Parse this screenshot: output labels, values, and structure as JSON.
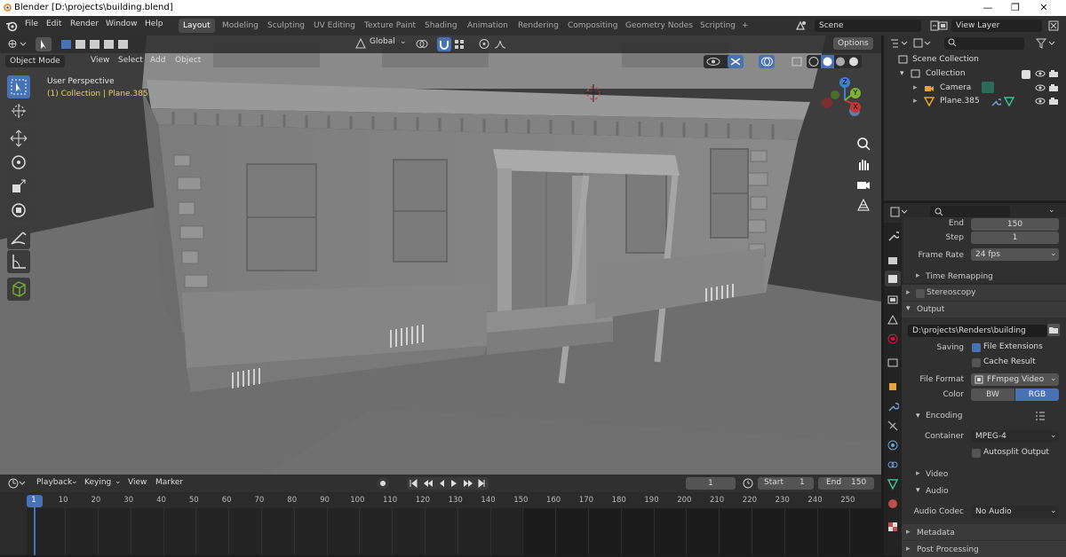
{
  "app": {
    "title": "Blender [D:\\projects\\building.blend]"
  },
  "window_controls": {
    "minimize": "—",
    "maximize": "❐",
    "close": "✕"
  },
  "menu": [
    "File",
    "Edit",
    "Render",
    "Window",
    "Help"
  ],
  "workspaces": [
    "Layout",
    "Modeling",
    "Sculpting",
    "UV Editing",
    "Texture Paint",
    "Shading",
    "Animation",
    "Rendering",
    "Compositing",
    "Geometry Nodes",
    "Scripting"
  ],
  "workspace_add": "+",
  "scene": {
    "name": "Scene"
  },
  "view_layer": {
    "name": "View Layer"
  },
  "viewport": {
    "mode": "Object Mode",
    "header_menus": [
      "View",
      "Select",
      "Add",
      "Object"
    ],
    "orientation": "Global",
    "options_label": "Options",
    "overlay_title": "User Perspective",
    "overlay_subtitle": "(1) Collection | Plane.385",
    "gizmo_x": "X",
    "gizmo_y": "Y",
    "gizmo_z": "Z"
  },
  "outliner": {
    "root": "Scene Collection",
    "items": [
      {
        "label": "Collection"
      },
      {
        "label": "Camera"
      },
      {
        "label": "Plane.385"
      }
    ]
  },
  "properties": {
    "end_label": "End",
    "end_value": "150",
    "step_label": "Step",
    "step_value": "1",
    "frame_rate_label": "Frame Rate",
    "frame_rate_value": "24 fps",
    "time_remapping": "Time Remapping",
    "stereoscopy": "Stereoscopy",
    "output": "Output",
    "output_path": "D:\\projects\\Renders\\building",
    "saving_label": "Saving",
    "file_extensions": "File Extensions",
    "cache_result": "Cache Result",
    "file_format_label": "File Format",
    "file_format_value": "FFmpeg Video",
    "color_label": "Color",
    "color_bw": "BW",
    "color_rgb": "RGB",
    "encoding": "Encoding",
    "container_label": "Container",
    "container_value": "MPEG-4",
    "autosplit_output": "Autosplit Output",
    "video": "Video",
    "audio": "Audio",
    "audio_codec_label": "Audio Codec",
    "audio_codec_value": "No Audio",
    "metadata": "Metadata",
    "post_processing": "Post Processing"
  },
  "timeline": {
    "menus": [
      "Playback",
      "Keying",
      "View",
      "Marker"
    ],
    "current_frame": "1",
    "start_label": "Start",
    "start_value": "1",
    "end_label": "End",
    "end_value": "150",
    "ticks": [
      "1",
      "10",
      "20",
      "30",
      "40",
      "50",
      "60",
      "70",
      "80",
      "90",
      "100",
      "110",
      "120",
      "130",
      "140",
      "150",
      "160",
      "170",
      "180",
      "190",
      "200",
      "210",
      "220",
      "230",
      "240",
      "250"
    ]
  },
  "colors": {
    "accent": "#4772b3",
    "panel": "#303030",
    "viewport": "#3d3d3d",
    "highlight_text": "#e8d35b"
  }
}
